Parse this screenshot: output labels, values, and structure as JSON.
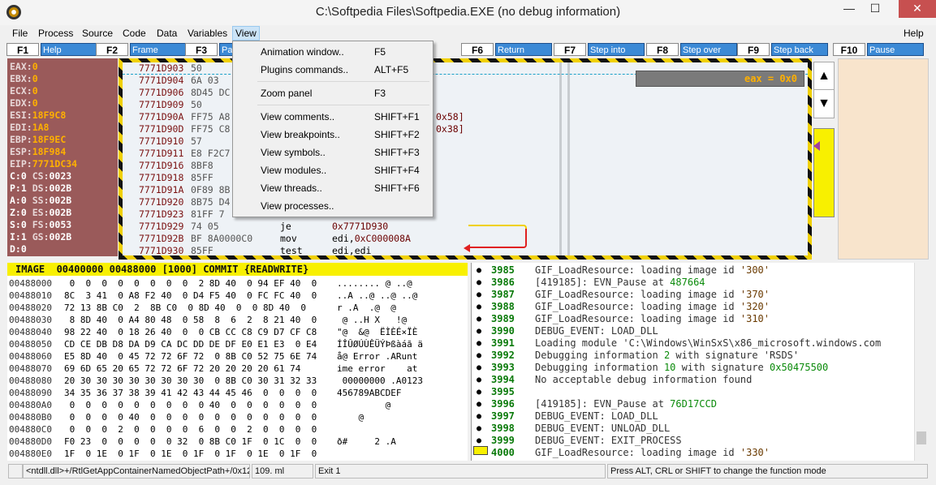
{
  "window": {
    "title": "C:\\Softpedia Files\\Softpedia.EXE (no debug information)",
    "minimize": "—",
    "maximize": "☐",
    "close": "✕"
  },
  "menubar": {
    "items": [
      "File",
      "Process",
      "Source",
      "Code",
      "Data",
      "Variables",
      "View"
    ],
    "help": "Help"
  },
  "fkeys": [
    {
      "key": "F1",
      "label": "Help"
    },
    {
      "key": "F2",
      "label": "Frame"
    },
    {
      "key": "F3",
      "label": "Pa"
    },
    {
      "key": "F6",
      "label": "Return"
    },
    {
      "key": "F7",
      "label": "Step into"
    },
    {
      "key": "F8",
      "label": "Step over"
    },
    {
      "key": "F9",
      "label": "Step back"
    },
    {
      "key": "F10",
      "label": "Pause"
    }
  ],
  "registers": [
    {
      "name": "EAX:",
      "value": "0"
    },
    {
      "name": "EBX:",
      "value": "0"
    },
    {
      "name": "ECX:",
      "value": "0"
    },
    {
      "name": "EDX:",
      "value": "0"
    },
    {
      "name": "ESI:",
      "value": "18F9C8"
    },
    {
      "name": "EDI:",
      "value": "1A8"
    },
    {
      "name": "EBP:",
      "value": "18F9EC"
    },
    {
      "name": "ESP:",
      "value": "18F984"
    },
    {
      "name": "EIP:",
      "value": "7771DC34"
    }
  ],
  "flags": [
    {
      "f": "C:0",
      "s": "CS:",
      "v": "0023"
    },
    {
      "f": "P:1",
      "s": "DS:",
      "v": "002B"
    },
    {
      "f": "A:0",
      "s": "SS:",
      "v": "002B"
    },
    {
      "f": "Z:0",
      "s": "ES:",
      "v": "002B"
    },
    {
      "f": "S:0",
      "s": "FS:",
      "v": "0053"
    },
    {
      "f": "I:1",
      "s": "GS:",
      "v": "002B"
    },
    {
      "f": "D:0",
      "s": "",
      "v": ""
    }
  ],
  "code": [
    {
      "addr": "7771D903",
      "hex": "50",
      "mn": "",
      "op": "",
      "num": ""
    },
    {
      "addr": "7771D904",
      "hex": "6A 03",
      "mn": "",
      "op": "",
      "num": ""
    },
    {
      "addr": "7771D906",
      "hex": "8D45 DC",
      "mn": "",
      "op": "",
      "num": ""
    },
    {
      "addr": "7771D909",
      "hex": "50",
      "mn": "",
      "op": "",
      "num": ""
    },
    {
      "addr": "7771D90A",
      "hex": "FF75 A8",
      "mn": "",
      "op": "",
      "num": "0x58]"
    },
    {
      "addr": "7771D90D",
      "hex": "FF75 C8",
      "mn": "",
      "op": "",
      "num": "0x38]"
    },
    {
      "addr": "7771D910",
      "hex": "57",
      "mn": "",
      "op": "",
      "num": ""
    },
    {
      "addr": "7771D911",
      "hex": "E8 F2C7",
      "mn": "",
      "op": "",
      "num": ""
    },
    {
      "addr": "7771D916",
      "hex": "8BF8",
      "mn": "",
      "op": "",
      "num": ""
    },
    {
      "addr": "7771D918",
      "hex": "85FF",
      "mn": "",
      "op": "",
      "num": ""
    },
    {
      "addr": "7771D91A",
      "hex": "0F89 8B",
      "mn": "",
      "op": "",
      "num": ""
    },
    {
      "addr": "7771D920",
      "hex": "8B75 D4",
      "mn": "",
      "op": "",
      "num": ""
    },
    {
      "addr": "7771D923",
      "hex": "81FF 7",
      "mn": "",
      "op": "",
      "num": ""
    },
    {
      "addr": "7771D929",
      "hex": "74 05",
      "mn": "je",
      "op": "",
      "num": "0x7771D930"
    },
    {
      "addr": "7771D92B",
      "hex": "BF 8A0000C0",
      "mn": "mov",
      "op": "edi,",
      "num": "0xC000008A"
    },
    {
      "addr": "7771D930",
      "hex": "85FF",
      "mn": "test",
      "op": "edi,edi",
      "num": ""
    }
  ],
  "eax_box": "eax = 0x0",
  "memory": {
    "header": "IMAGE  00400000 00488000 [1000] COMMIT {READWRITE}",
    "rows": [
      {
        "a": "00488000",
        "b": " 0  0  0  0  0  0  0  0  2 8D 40  0 94 EF 40  0",
        "c": "........ @ ..@"
      },
      {
        "a": "00488010",
        "b": "8C  3 41  0 A8 F2 40  0 D4 F5 40  0 FC FC 40  0",
        "c": "..A ..@ ..@ ..@"
      },
      {
        "a": "00488020",
        "b": "72 13 8B C0  2  8B C0  0 8D 40  0  0 8D 40  0",
        "c": "r .A  .@  @"
      },
      {
        "a": "00488030",
        "b": " 8 8D 40  0 A4 80 48  0 58  8  6  2  8 21 40  0",
        "c": " @ ..H X   !@"
      },
      {
        "a": "00488040",
        "b": "98 22 40  0 18 26 40  0  0 CB CC C8 C9 D7 CF C8",
        "c": "\"@  &@  ËÌÈÉ×ÏÈ"
      },
      {
        "a": "00488050",
        "b": "CD CE DB D8 DA D9 CA DC DD DE DF E0 E1 E3  0 E4",
        "c": "ÍÎÛØÚÙÊÜÝÞßàáã ä"
      },
      {
        "a": "00488060",
        "b": "E5 8D 40  0 45 72 72 6F 72  0 8B C0 52 75 6E 74",
        "c": "å@ Error .ARunt"
      },
      {
        "a": "00488070",
        "b": "69 6D 65 20 65 72 72 6F 72 20 20 20 20 61 74",
        "c": "ime error    at"
      },
      {
        "a": "00488080",
        "b": "20 30 30 30 30 30 30 30 30  0 8B C0 30 31 32 33",
        "c": " 00000000 .A0123"
      },
      {
        "a": "00488090",
        "b": "34 35 36 37 38 39 41 42 43 44 45 46  0  0  0  0",
        "c": "456789ABCDEF"
      },
      {
        "a": "004880A0",
        "b": " 0  0  0  0  0  0  0  0  0 40  0  0  0  0  0  0",
        "c": "         @"
      },
      {
        "a": "004880B0",
        "b": " 0  0  0  0 40  0  0  0  0  0  0  0  0  0  0  0",
        "c": "    @"
      },
      {
        "a": "004880C0",
        "b": " 0  0  0  2  0  0  0  0  6  0  0  2  0  0  0  0",
        "c": ""
      },
      {
        "a": "004880D0",
        "b": "F0 23  0  0  0  0  0 32  0 8B C0 1F  0 1C  0  0",
        "c": "ð#     2 .A"
      },
      {
        "a": "004880E0",
        "b": "1F  0 1E  0 1F  0 1E  0 1F  0 1F  0 1E  0 1F  0",
        "c": ""
      }
    ]
  },
  "log": [
    {
      "n": "3985",
      "parts": [
        [
          "GIF_LoadResource: loading image id ",
          ""
        ],
        [
          "'300'",
          "br"
        ]
      ]
    },
    {
      "n": "3986",
      "parts": [
        [
          "[419185]: EVN_Pause at ",
          ""
        ],
        [
          "487664",
          "g"
        ]
      ]
    },
    {
      "n": "3987",
      "parts": [
        [
          "GIF_LoadResource: loading image id ",
          ""
        ],
        [
          "'370'",
          "br"
        ]
      ]
    },
    {
      "n": "3988",
      "parts": [
        [
          "GIF_LoadResource: loading image id ",
          ""
        ],
        [
          "'320'",
          "br"
        ]
      ]
    },
    {
      "n": "3989",
      "parts": [
        [
          "GIF_LoadResource: loading image id ",
          ""
        ],
        [
          "'310'",
          "br"
        ]
      ]
    },
    {
      "n": "3990",
      "parts": [
        [
          "DEBUG_EVENT: LOAD_DLL",
          ""
        ]
      ]
    },
    {
      "n": "3991",
      "parts": [
        [
          "Loading module 'C:\\Windows\\WinSxS\\x86_microsoft.windows.com",
          ""
        ]
      ]
    },
    {
      "n": "3992",
      "parts": [
        [
          "Debugging information ",
          ""
        ],
        [
          "2",
          "g"
        ],
        [
          " with signature 'RSDS'",
          ""
        ]
      ]
    },
    {
      "n": "3993",
      "parts": [
        [
          "Debugging information ",
          ""
        ],
        [
          "10",
          "g"
        ],
        [
          " with signature ",
          ""
        ],
        [
          "0x50475500",
          "g"
        ]
      ]
    },
    {
      "n": "3994",
      "parts": [
        [
          "No acceptable debug information found",
          ""
        ]
      ]
    },
    {
      "n": "3995",
      "parts": [
        [
          "",
          ""
        ]
      ]
    },
    {
      "n": "3996",
      "parts": [
        [
          "[419185]: EVN_Pause at ",
          ""
        ],
        [
          "76D17CCD",
          "g"
        ]
      ]
    },
    {
      "n": "3997",
      "parts": [
        [
          "DEBUG_EVENT: LOAD_DLL",
          ""
        ]
      ]
    },
    {
      "n": "3998",
      "parts": [
        [
          "DEBUG_EVENT: UNLOAD_DLL",
          ""
        ]
      ]
    },
    {
      "n": "3999",
      "parts": [
        [
          "DEBUG_EVENT: EXIT_PROCESS",
          ""
        ]
      ]
    },
    {
      "n": "4000",
      "parts": [
        [
          "GIF_LoadResource: loading image id ",
          ""
        ],
        [
          "'330'",
          "br"
        ]
      ]
    }
  ],
  "status": {
    "s1": "",
    "s2": "<ntdll.dll>+/RtlGetAppContainerNamedObjectPath+/0x12",
    "s3": "109. ml",
    "s4": "Exit 1",
    "s5": "Press ALT, CRL or SHIFT to change the function mode"
  },
  "view_menu": [
    {
      "label": "Animation window..",
      "shortcut": "F5"
    },
    {
      "label": "Plugins commands..",
      "shortcut": "ALT+F5"
    },
    {
      "label": "Zoom panel",
      "shortcut": "F3"
    },
    {
      "label": "View comments..",
      "shortcut": "SHIFT+F1"
    },
    {
      "label": "View breakpoints..",
      "shortcut": "SHIFT+F2"
    },
    {
      "label": "View symbols..",
      "shortcut": "SHIFT+F3"
    },
    {
      "label": "View modules..",
      "shortcut": "SHIFT+F4"
    },
    {
      "label": "View threads..",
      "shortcut": "SHIFT+F6"
    },
    {
      "label": "View processes..",
      "shortcut": ""
    }
  ]
}
